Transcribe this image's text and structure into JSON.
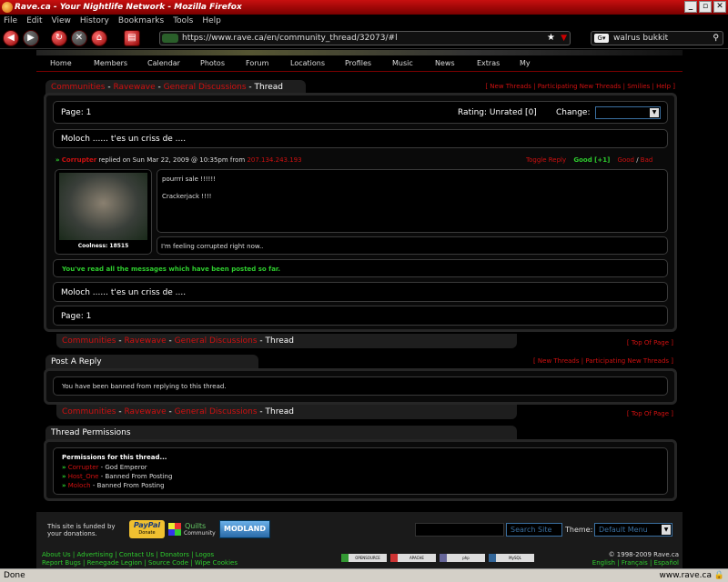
{
  "window": {
    "title": "Rave.ca - Your Nightlife Network - Mozilla Firefox"
  },
  "menu": [
    "File",
    "Edit",
    "View",
    "History",
    "Bookmarks",
    "Tools",
    "Help"
  ],
  "browser": {
    "url": "https://www.rave.ca/en/community_thread/32073/#l",
    "search_value": "walrus bukkit"
  },
  "sitenav": [
    "Home",
    "Members",
    "Calendar",
    "Photos",
    "Forum",
    "Locations",
    "Profiles",
    "Music",
    "News",
    "Extras",
    "My"
  ],
  "breadcrumb": {
    "communities": "Communities",
    "sep": " - ",
    "ravewave": "Ravewave",
    "general": "General Discussions",
    "thread": "Thread"
  },
  "toplinks": "[ New Threads | Participating New Threads | Smilies | Help ]",
  "thread": {
    "page_label": "Page: 1",
    "rating_label": "Rating: Unrated [0]",
    "change_label": "Change:",
    "title": "Moloch ...... t'es un criss de ....",
    "post": {
      "author": "Corrupter",
      "meta": " replied on Sun Mar 22, 2009 @ 10:35pm from ",
      "ip": "207.134.243.193",
      "toggle": "Toggle Reply",
      "good_count": "Good [+1]",
      "good": "Good",
      "slash": " / ",
      "bad": "Bad",
      "line1": "pourrri sale !!!!!!",
      "line2": "Crackerjack !!!!",
      "signature": "I'm feeling corrupted right now..",
      "coolness": "Coolness: 18515"
    },
    "read_all": "You've read all the messages which have been posted so far.",
    "bottom_title": "Moloch ...... t'es un criss de ....",
    "bottom_page": "Page: 1"
  },
  "top_of_page": "[ Top Of Page ]",
  "reply": {
    "title": "Post A Reply",
    "links": "[ New Threads | Participating New Threads ]",
    "message": "You have been banned from replying to this thread."
  },
  "permissions": {
    "title": "Thread Permissions",
    "heading": "Permissions for this thread...",
    "items": [
      {
        "name": "Corrupter",
        "role": " - God Emperor"
      },
      {
        "name": "Host_One",
        "role": " - Banned From Posting"
      },
      {
        "name": "Moloch",
        "role": " - Banned From Posting"
      }
    ]
  },
  "footer": {
    "funded": "This site is funded by",
    "funded2": "your donations.",
    "paypal": "PayPal",
    "paypal_sub": "Donate",
    "quilts": "Quilts",
    "quilts_sub": "Community",
    "modland": "MODLAND",
    "search_placeholder": "Search Site",
    "theme_label": "Theme:",
    "theme_value": "Default Menu",
    "links1": "About Us | Advertising | Contact Us | Donators | Logos",
    "links2": "Report Bugs | Renegade Legion | Source Code | Wipe Cookies",
    "copyright": "© 1998-2009 Rave.ca",
    "langs": "English | Français | Español",
    "badges": [
      "OPENSOURCE",
      "APACHE",
      "php",
      "MySQL"
    ]
  },
  "status": {
    "left": "Done",
    "right": "www.rave.ca"
  }
}
